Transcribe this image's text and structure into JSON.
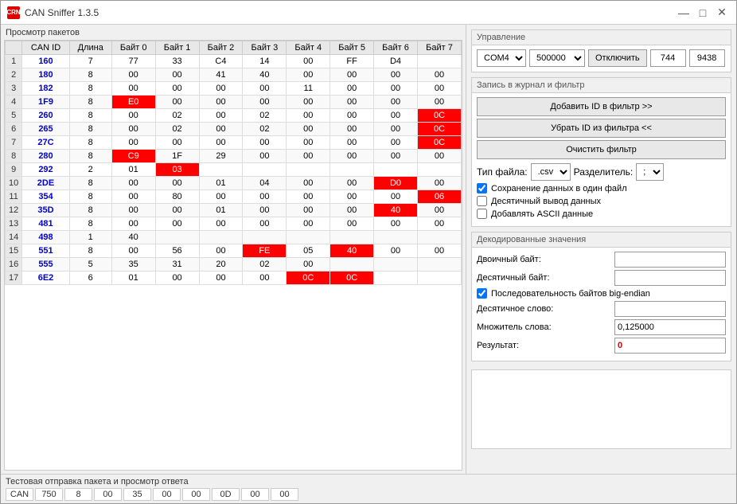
{
  "titleBar": {
    "icon": "CRN",
    "title": "CAN Sniffer 1.3.5",
    "minimize": "—",
    "maximize": "□",
    "close": "✕"
  },
  "leftPanel": {
    "sectionLabel": "Просмотр пакетов",
    "tableHeaders": [
      "",
      "CAN ID",
      "Длина",
      "Байт 0",
      "Байт 1",
      "Байт 2",
      "Байт 3",
      "Байт 4",
      "Байт 5",
      "Байт 6",
      "Байт 7"
    ],
    "rows": [
      {
        "num": "1",
        "id": "160",
        "len": "7",
        "b0": "77",
        "b1": "33",
        "b2": "C4",
        "b3": "14",
        "b4": "00",
        "b5": "FF",
        "b6": "D4",
        "b7": "",
        "b0r": false,
        "b1r": false,
        "b2r": false,
        "b3r": false,
        "b4r": false,
        "b5r": false,
        "b6r": false,
        "b7r": false
      },
      {
        "num": "2",
        "id": "180",
        "len": "8",
        "b0": "00",
        "b1": "00",
        "b2": "41",
        "b3": "40",
        "b4": "00",
        "b5": "00",
        "b6": "00",
        "b7": "00",
        "b0r": false,
        "b1r": false,
        "b2r": false,
        "b3r": false,
        "b4r": false,
        "b5r": false,
        "b6r": false,
        "b7r": false
      },
      {
        "num": "3",
        "id": "182",
        "len": "8",
        "b0": "00",
        "b1": "00",
        "b2": "00",
        "b3": "00",
        "b4": "11",
        "b5": "00",
        "b6": "00",
        "b7": "00",
        "b0r": false,
        "b1r": false,
        "b2r": false,
        "b3r": false,
        "b4r": false,
        "b5r": false,
        "b6r": false,
        "b7r": false
      },
      {
        "num": "4",
        "id": "1F9",
        "len": "8",
        "b0": "E0",
        "b1": "00",
        "b2": "00",
        "b3": "00",
        "b4": "00",
        "b5": "00",
        "b6": "00",
        "b7": "00",
        "b0r": true,
        "b1r": false,
        "b2r": false,
        "b3r": false,
        "b4r": false,
        "b5r": false,
        "b6r": false,
        "b7r": false
      },
      {
        "num": "5",
        "id": "260",
        "len": "8",
        "b0": "00",
        "b1": "02",
        "b2": "00",
        "b3": "02",
        "b4": "00",
        "b5": "00",
        "b6": "00",
        "b7": "0C",
        "b0r": false,
        "b1r": false,
        "b2r": false,
        "b3r": false,
        "b4r": false,
        "b5r": false,
        "b6r": false,
        "b7r": true
      },
      {
        "num": "6",
        "id": "265",
        "len": "8",
        "b0": "00",
        "b1": "02",
        "b2": "00",
        "b3": "02",
        "b4": "00",
        "b5": "00",
        "b6": "00",
        "b7": "0C",
        "b0r": false,
        "b1r": false,
        "b2r": false,
        "b3r": false,
        "b4r": false,
        "b5r": false,
        "b6r": false,
        "b7r": true
      },
      {
        "num": "7",
        "id": "27C",
        "len": "8",
        "b0": "00",
        "b1": "00",
        "b2": "00",
        "b3": "00",
        "b4": "00",
        "b5": "00",
        "b6": "00",
        "b7": "0C",
        "b0r": false,
        "b1r": false,
        "b2r": false,
        "b3r": false,
        "b4r": false,
        "b5r": false,
        "b6r": false,
        "b7r": true
      },
      {
        "num": "8",
        "id": "280",
        "len": "8",
        "b0": "C9",
        "b1": "1F",
        "b2": "29",
        "b3": "00",
        "b4": "00",
        "b5": "00",
        "b6": "00",
        "b7": "00",
        "b0r": true,
        "b1r": false,
        "b2r": false,
        "b3r": false,
        "b4r": false,
        "b5r": false,
        "b6r": false,
        "b7r": false
      },
      {
        "num": "9",
        "id": "292",
        "len": "2",
        "b0": "01",
        "b1": "03",
        "b2": "",
        "b3": "",
        "b4": "",
        "b5": "",
        "b6": "",
        "b7": "",
        "b0r": false,
        "b1r": true,
        "b2r": false,
        "b3r": false,
        "b4r": false,
        "b5r": false,
        "b6r": false,
        "b7r": false
      },
      {
        "num": "10",
        "id": "2DE",
        "len": "8",
        "b0": "00",
        "b1": "00",
        "b2": "01",
        "b3": "04",
        "b4": "00",
        "b5": "00",
        "b6": "D0",
        "b7": "00",
        "b0r": false,
        "b1r": false,
        "b2r": false,
        "b3r": false,
        "b4r": false,
        "b5r": false,
        "b6r": true,
        "b7r": false
      },
      {
        "num": "11",
        "id": "354",
        "len": "8",
        "b0": "00",
        "b1": "80",
        "b2": "00",
        "b3": "00",
        "b4": "00",
        "b5": "00",
        "b6": "00",
        "b7": "06",
        "b0r": false,
        "b1r": false,
        "b2r": false,
        "b3r": false,
        "b4r": false,
        "b5r": false,
        "b6r": false,
        "b7r": true
      },
      {
        "num": "12",
        "id": "35D",
        "len": "8",
        "b0": "00",
        "b1": "00",
        "b2": "01",
        "b3": "00",
        "b4": "00",
        "b5": "00",
        "b6": "40",
        "b7": "00",
        "b0r": false,
        "b1r": false,
        "b2r": false,
        "b3r": false,
        "b4r": false,
        "b5r": false,
        "b6r": true,
        "b7r": false
      },
      {
        "num": "13",
        "id": "481",
        "len": "8",
        "b0": "00",
        "b1": "00",
        "b2": "00",
        "b3": "00",
        "b4": "00",
        "b5": "00",
        "b6": "00",
        "b7": "00",
        "b0r": false,
        "b1r": false,
        "b2r": false,
        "b3r": false,
        "b4r": false,
        "b5r": false,
        "b6r": false,
        "b7r": false
      },
      {
        "num": "14",
        "id": "498",
        "len": "1",
        "b0": "40",
        "b1": "",
        "b2": "",
        "b3": "",
        "b4": "",
        "b5": "",
        "b6": "",
        "b7": "",
        "b0r": false,
        "b1r": false,
        "b2r": false,
        "b3r": false,
        "b4r": false,
        "b5r": false,
        "b6r": false,
        "b7r": false
      },
      {
        "num": "15",
        "id": "551",
        "len": "8",
        "b0": "00",
        "b1": "56",
        "b2": "00",
        "b3": "FE",
        "b4": "05",
        "b5": "40",
        "b6": "00",
        "b7": "00",
        "b0r": false,
        "b1r": false,
        "b2r": false,
        "b3r": true,
        "b4r": false,
        "b5r": true,
        "b6r": false,
        "b7r": false
      },
      {
        "num": "16",
        "id": "555",
        "len": "5",
        "b0": "35",
        "b1": "31",
        "b2": "20",
        "b3": "02",
        "b4": "00",
        "b5": "",
        "b6": "",
        "b7": "",
        "b0r": false,
        "b1r": false,
        "b2r": false,
        "b3r": false,
        "b4r": false,
        "b5r": false,
        "b6r": false,
        "b7r": false
      },
      {
        "num": "17",
        "id": "6E2",
        "len": "6",
        "b0": "01",
        "b1": "00",
        "b2": "00",
        "b3": "00",
        "b4": "0C",
        "b5": "0C",
        "b6": "",
        "b7": "",
        "b0r": false,
        "b1r": false,
        "b2r": false,
        "b3r": false,
        "b4r": true,
        "b5r": true,
        "b6r": false,
        "b7r": false
      }
    ]
  },
  "rightPanel": {
    "controlTitle": "Управление",
    "comPort": "COM4",
    "baudRate": "500000",
    "disconnectBtn": "Отключить",
    "val1": "744",
    "val2": "9438",
    "journalTitle": "Запись в журнал и фильтр",
    "addIdBtn": "Добавить ID в фильтр >>",
    "removeIdBtn": "Убрать ID из фильтра <<",
    "clearFilterBtn": "Очистить фильтр",
    "fileTypeLabel": "Тип файла:",
    "fileTypeValue": ".csv",
    "delimiterLabel": "Разделитель:",
    "delimiterValue": ";",
    "saveSingleFile": "Сохранение данных в один файл",
    "decimalOutput": "Десятичный вывод данных",
    "addAscii": "Добавлять ASCII данные",
    "decodedTitle": "Декодированные значения",
    "binaryByteLabel": "Двоичный байт:",
    "decimalByteLabel": "Десятичный байт:",
    "bigEndianLabel": "Последовательность байтов big-endian",
    "decimalWordLabel": "Десятичное слово:",
    "multiplierLabel": "Множитель слова:",
    "multiplierValue": "0,125000",
    "resultLabel": "Результат:",
    "resultValue": "0"
  },
  "bottomBar": {
    "label": "Тестовая отправка пакета и просмотр ответа",
    "canLabel": "CAN",
    "cells": [
      "750",
      "8",
      "00",
      "35",
      "00",
      "00",
      "0D",
      "00",
      "00"
    ]
  }
}
